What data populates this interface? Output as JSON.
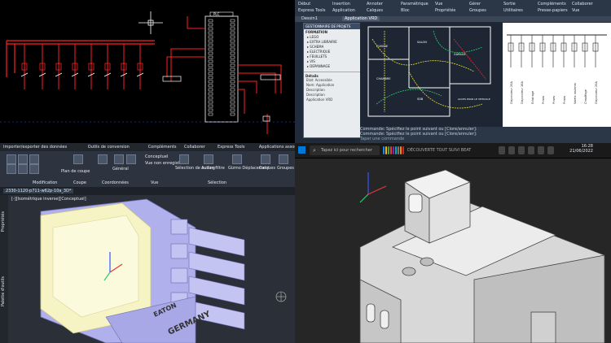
{
  "tl": {
    "plc_label": "PLC",
    "title": "PLC"
  },
  "tr": {
    "menu": [
      "Début",
      "Insertion",
      "Annoter",
      "Paramétrique",
      "Vue",
      "Gérer",
      "Sortie",
      "Compléments",
      "Collaborer",
      "Express Tools",
      "Application",
      "Calques",
      "Bloc",
      "Propriétés",
      "Groupes",
      "Utilitaires",
      "Presse-papiers",
      "Vue"
    ],
    "file_tab": "Dessin1",
    "layout_tab": "Application VRD",
    "project_panel_title": "GESTIONNAIRE DE PROJETS",
    "project_section": "FORMATION",
    "project_items": [
      "LEGO",
      "EXTRA LIBRAIRIE",
      "SCHEMA",
      "ELECTRIQUE",
      "FEUILLETS",
      "VIS",
      "DEPANNAGE"
    ],
    "details_title": "Détails",
    "details_lines": [
      "Etat: Accessible",
      "Nom: Application",
      "Description",
      "Description",
      "Application VRD"
    ],
    "plan_labels": [
      "CUISINE",
      "SALON",
      "CHAMBRE",
      "SDB",
      "SEJOUR",
      "GARAGE",
      "ACCES POUR LE VEHICULE"
    ],
    "cmd_lines": [
      "Commande: Spécifiez le point suivant ou [Clore/annuler]:",
      "Commande: Spécifiez le point suivant ou [Clore/annuler]:"
    ],
    "cmd_prompt": "Taper une commande",
    "schematic_labels": [
      "Disjoncteur 20A",
      "Disjoncteur 16A",
      "Eclairage",
      "Prises",
      "Prises",
      "Prises",
      "Volets roulants",
      "Chauffage"
    ]
  },
  "bl": {
    "menu": [
      "Importer/exporter des données",
      "Outils de conversion",
      "Compléments",
      "Collaborer",
      "Express Tools",
      "Applications associées"
    ],
    "tools": [
      {
        "label": "Plan de coupe",
        "name": "section-plane-button"
      },
      {
        "label": "Modification",
        "name": "modify-panel-label"
      },
      {
        "label": "Coupe",
        "name": "section-panel-label"
      },
      {
        "label": "Coordonnées",
        "name": "coordinates-panel-label"
      },
      {
        "label": "Conceptuel",
        "name": "visual-style-dropdown"
      },
      {
        "label": "Vue non enregistrée",
        "name": "view-dropdown"
      },
      {
        "label": "Général",
        "name": "general-dropdown"
      },
      {
        "label": "Vue",
        "name": "view-panel-label"
      },
      {
        "label": "Sélection",
        "name": "selection-panel-label"
      },
      {
        "label": "Sélection de culling",
        "name": "culling-button"
      },
      {
        "label": "Aucun filtre",
        "name": "no-filter-button"
      },
      {
        "label": "Gizmo Déplacement",
        "name": "move-gizmo-button"
      },
      {
        "label": "Calques",
        "name": "layers-button"
      },
      {
        "label": "Groupes",
        "name": "groups-button"
      }
    ],
    "file_tab": "2330-1120-p711-w62p-10a_3D*",
    "viewport_label": "[-][Isométrique inverse][Conceptuel]",
    "side_labels": [
      "Propriétés",
      "Palette d'outils"
    ],
    "part_text": "GERMANY",
    "brand_text": "EATON"
  },
  "br": {
    "search_placeholder": "Tapez ici pour rechercher",
    "status_text": "DÉCOUVERTE TOUT SUIVI BEAT",
    "clock_time": "16:28",
    "clock_date": "21/06/2022",
    "taskbar_colors": [
      "#1e88e5",
      "#ffb300",
      "#43a047",
      "#e53935",
      "#5e35b1",
      "#00acc1",
      "#8d6e63",
      "#fb8c00",
      "#c62828"
    ]
  },
  "colors": {
    "red_wire": "#ff2020",
    "white_wire": "#ffffff",
    "plan_yellow": "#e8e238",
    "plan_green": "#2ecc71",
    "ribbon_dark": "#2d3440",
    "ribbon_light": "#3b4351",
    "part_lavender": "#b8b8f0",
    "part_yellow": "#f8f6c8"
  }
}
